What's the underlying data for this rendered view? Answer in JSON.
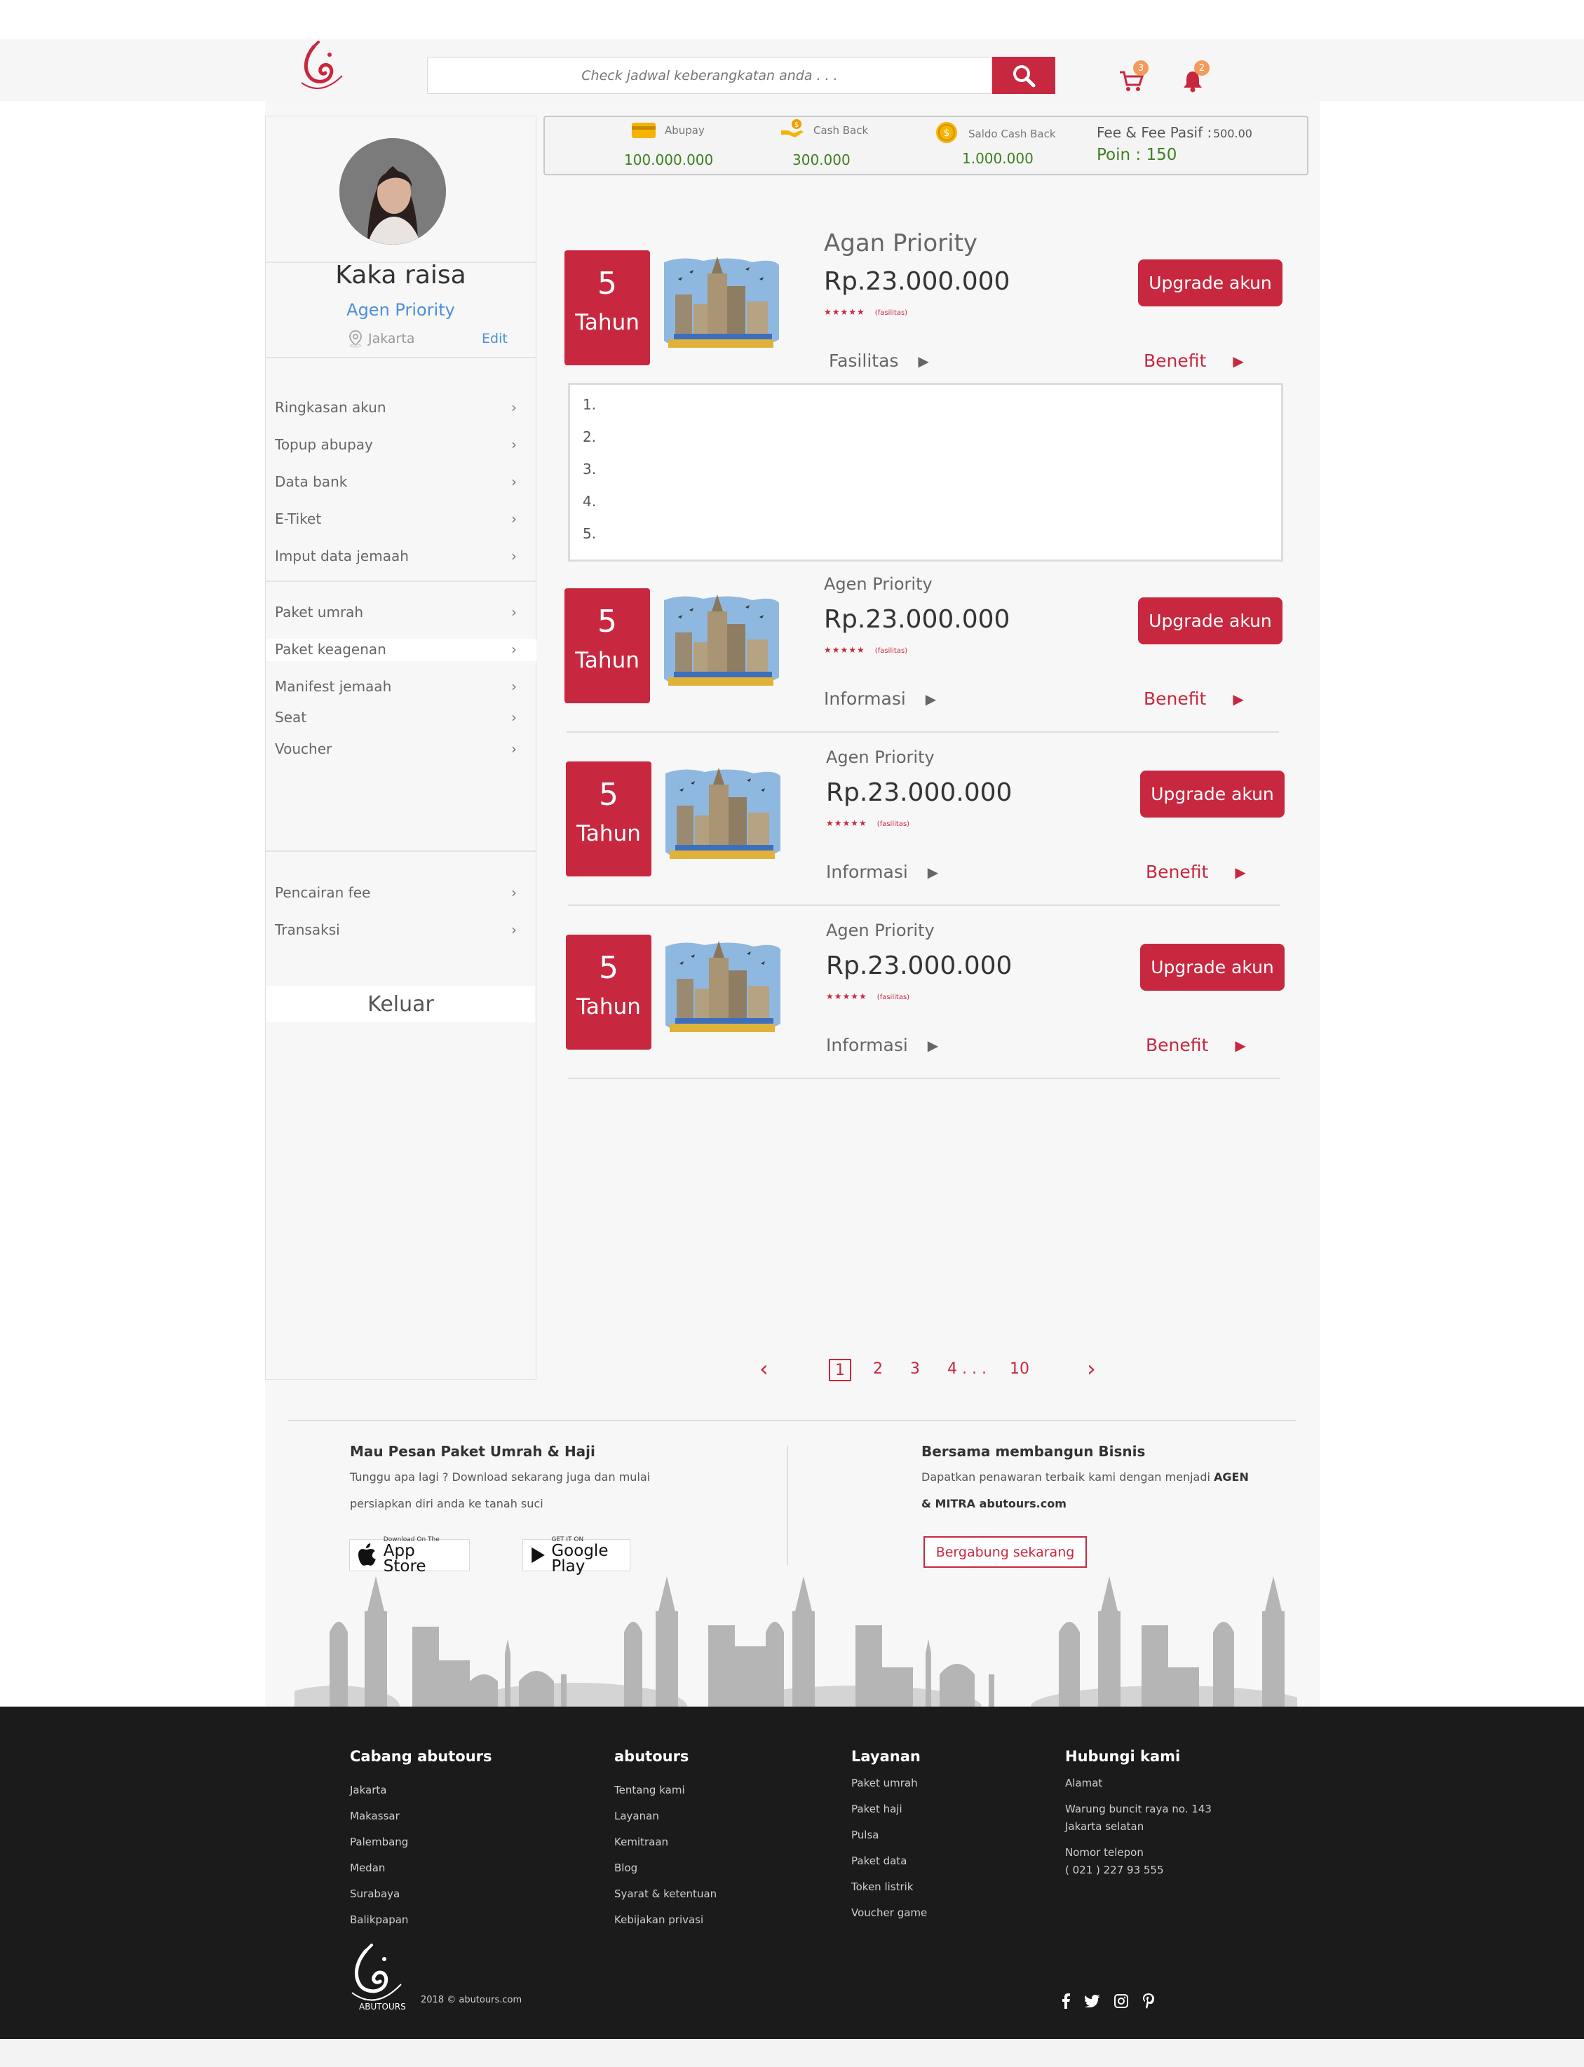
{
  "header": {
    "search_placeholder": "Check jadwal keberangkatan anda . . .",
    "cart_count": "3",
    "notif_count": "2"
  },
  "wallet": {
    "abupay_label": "Abupay",
    "abupay_value": "100.000.000",
    "cashback_label": "Cash Back",
    "cashback_value": "300.000",
    "saldo_label": "Saldo Cash Back",
    "saldo_value": "1.000.000",
    "fee_label": "Fee & Fee Pasif :",
    "fee_value": "500.00",
    "poin_label": "Poin : 150"
  },
  "profile": {
    "name": "Kaka raisa",
    "role": "Agen Priority",
    "location": "Jakarta",
    "edit": "Edit"
  },
  "menu": {
    "group1": [
      "Ringkasan akun",
      "Topup abupay",
      "Data bank",
      "E-Tiket",
      "Imput data jemaah"
    ],
    "group2": [
      "Paket umrah",
      "Paket keagenan",
      "Manifest jemaah",
      "Seat",
      "Voucher"
    ],
    "group3": [
      "Pencairan fee",
      "Transaksi"
    ],
    "active": "Paket keagenan",
    "logout": "Keluar"
  },
  "packages": [
    {
      "years": "5",
      "years_label": "Tahun",
      "title": "Agan Priority",
      "price": "Rp.23.000.000",
      "stars": "★★★★★",
      "fasilitas": "(fasilitas)",
      "link": "Fasilitas",
      "benefit": "Benefit",
      "button": "Upgrade akun"
    },
    {
      "years": "5",
      "years_label": "Tahun",
      "title": "Agen Priority",
      "price": "Rp.23.000.000",
      "stars": "★★★★★",
      "fasilitas": "(fasilitas)",
      "link": "Informasi",
      "benefit": "Benefit",
      "button": "Upgrade akun"
    },
    {
      "years": "5",
      "years_label": "Tahun",
      "title": "Agen Priority",
      "price": "Rp.23.000.000",
      "stars": "★★★★★",
      "fasilitas": "(fasilitas)",
      "link": "Informasi",
      "benefit": "Benefit",
      "button": "Upgrade akun"
    },
    {
      "years": "5",
      "years_label": "Tahun",
      "title": "Agen Priority",
      "price": "Rp.23.000.000",
      "stars": "★★★★★",
      "fasilitas": "(fasilitas)",
      "link": "Informasi",
      "benefit": "Benefit",
      "button": "Upgrade akun"
    }
  ],
  "facility_list": [
    "1.",
    "2.",
    "3.",
    "4.",
    "5."
  ],
  "pagination": {
    "prev": "‹",
    "pages": [
      "1",
      "2",
      "3",
      "4 . . .",
      "10"
    ],
    "current": "1",
    "next": "›"
  },
  "promo": {
    "left_title": "Mau Pesan Paket Umrah & Haji",
    "left_line1": "Tunggu apa lagi ? Download sekarang juga dan mulai",
    "left_line2": "persiapkan diri anda ke tanah suci",
    "appstore_small": "Download On The",
    "appstore_big": "App Store",
    "gplay_small": "GET IT ON",
    "gplay_big": "Google Play",
    "right_title": "Bersama membangun Bisnis",
    "right_line1": "Dapatkan penawaran terbaik kami dengan menjadi",
    "right_line1_bold": "AGEN",
    "right_line2_bold": "& MITRA abutours.com",
    "join": "Bergabung sekarang"
  },
  "footer": {
    "col1_title": "Cabang abutours",
    "col1": [
      "Jakarta",
      "Makassar",
      "Palembang",
      "Medan",
      "Surabaya",
      "Balikpapan"
    ],
    "col2_title": "abutours",
    "col2": [
      "Tentang kami",
      "Layanan",
      "Kemitraan",
      "Blog",
      "Syarat & ketentuan",
      "Kebijakan privasi"
    ],
    "col3_title": "Layanan",
    "col3": [
      "Paket umrah",
      "Paket haji",
      "Pulsa",
      "Paket data",
      "Token listrik",
      "Voucher game"
    ],
    "col4_title": "Hubungi kami",
    "addr_label": "Alamat",
    "addr1": "Warung buncit raya no. 143",
    "addr2": "Jakarta selatan",
    "phone_label": "Nomor telepon",
    "phone": "( 021 )  227 93 555",
    "copyright": "2018 © abutours.com",
    "logo_text": "ABUTOURS"
  },
  "colors": {
    "accent": "#c8283f",
    "money_green": "#3f7d20",
    "link_blue": "#4a90d9",
    "footer_bg": "#1b1b1b"
  }
}
